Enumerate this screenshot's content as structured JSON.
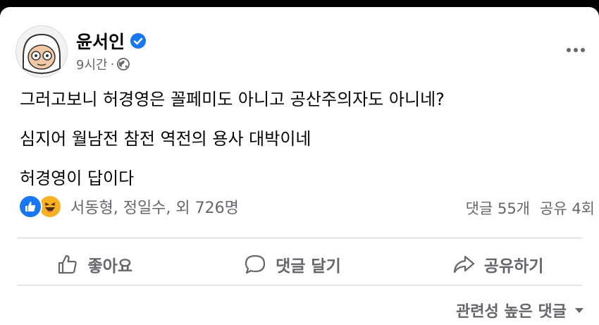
{
  "post": {
    "author": "윤서인",
    "time": "9시간",
    "separator": "·",
    "lines": [
      "그러고보니 허경영은 꼴페미도 아니고 공산주의자도 아니네?",
      "심지어 월남전 참전 역전의 용사 대박이네",
      "허경영이 답이다"
    ]
  },
  "reactions": {
    "names": "서동형, 정일수, 외 726명",
    "comments": "댓글 55개",
    "shares": "공유 4회"
  },
  "actions": {
    "like": "좋아요",
    "comment": "댓글 달기",
    "share": "공유하기"
  },
  "sort_label": "관련성 높은 댓글",
  "colors": {
    "accent": "#1877f2",
    "muted": "#65676b",
    "text": "#050505",
    "divider": "#ced0d4"
  },
  "icons": [
    "verified-badge-icon",
    "globe-icon",
    "more-options-icon",
    "like-reaction-icon",
    "haha-reaction-icon",
    "thumbs-up-icon",
    "comment-icon",
    "share-icon",
    "caret-down-icon"
  ]
}
